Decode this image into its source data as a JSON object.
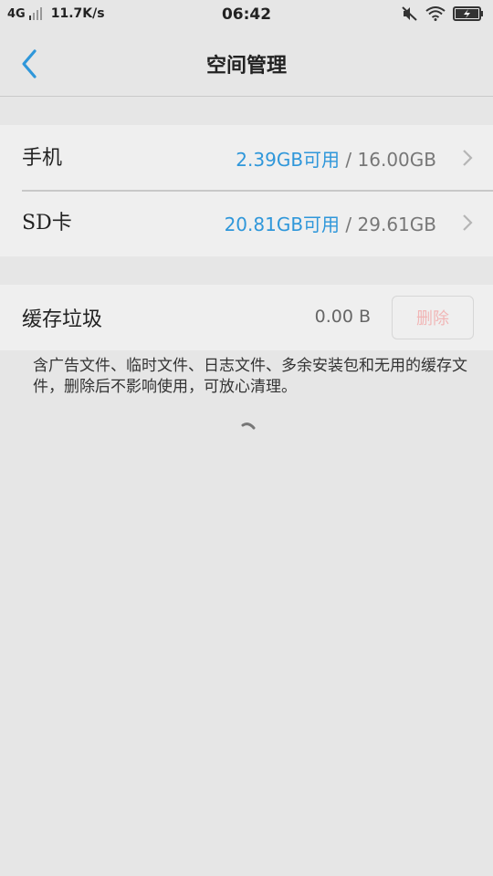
{
  "status_bar": {
    "network": "4G",
    "speed": "11.7K/s",
    "time": "06:42"
  },
  "header": {
    "title": "空间管理"
  },
  "storage": [
    {
      "label": "手机",
      "available": "2.39GB可用",
      "separator": "/",
      "total": "16.00GB"
    },
    {
      "label": "SD卡",
      "available": "20.81GB可用",
      "separator": "/",
      "total": "29.61GB"
    }
  ],
  "cache": {
    "label": "缓存垃圾",
    "size": "0.00 B",
    "delete_label": "删除"
  },
  "description": "含广告文件、临时文件、日志文件、多余安装包和无用的缓存文件，删除后不影响使用，可放心清理。",
  "colors": {
    "accent": "#2f97da",
    "delete_disabled": "#f1b6b6"
  }
}
